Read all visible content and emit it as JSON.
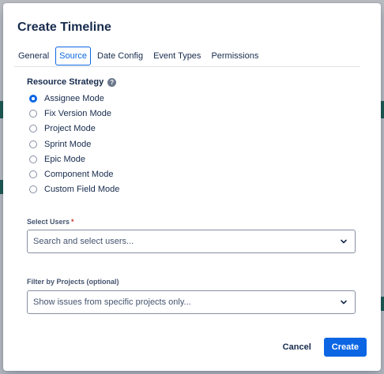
{
  "dialog": {
    "title": "Create Timeline"
  },
  "tabs": [
    {
      "label": "General",
      "active": false
    },
    {
      "label": "Source",
      "active": true
    },
    {
      "label": "Date Config",
      "active": false
    },
    {
      "label": "Event Types",
      "active": false
    },
    {
      "label": "Permissions",
      "active": false
    }
  ],
  "resource_strategy": {
    "label": "Resource Strategy",
    "help_icon": "question-circle-icon",
    "options": [
      {
        "label": "Assignee Mode",
        "checked": true
      },
      {
        "label": "Fix Version Mode",
        "checked": false
      },
      {
        "label": "Project Mode",
        "checked": false
      },
      {
        "label": "Sprint Mode",
        "checked": false
      },
      {
        "label": "Epic Mode",
        "checked": false
      },
      {
        "label": "Component Mode",
        "checked": false
      },
      {
        "label": "Custom Field Mode",
        "checked": false
      }
    ]
  },
  "select_users": {
    "label": "Select Users",
    "required_marker": "*",
    "placeholder": "Search and select users..."
  },
  "filter_projects": {
    "label": "Filter by Projects (optional)",
    "placeholder": "Show issues from specific projects only..."
  },
  "footer": {
    "cancel_label": "Cancel",
    "create_label": "Create"
  },
  "colors": {
    "primary": "#0c66e4",
    "required": "#c9372c",
    "text": "#172b4d"
  }
}
